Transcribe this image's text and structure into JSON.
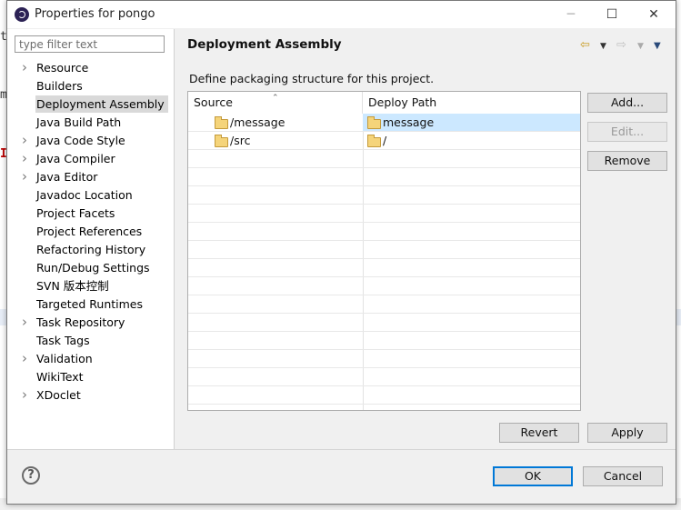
{
  "window": {
    "title": "Properties for pongo",
    "minimize_glyph": "─",
    "maximize_glyph": "☐",
    "close_glyph": "✕"
  },
  "background_editor": {
    "chars": [
      "t",
      "m",
      "I"
    ]
  },
  "filter": {
    "placeholder": "type filter text",
    "value": ""
  },
  "nav": {
    "items": [
      {
        "label": "Resource",
        "expandable": true
      },
      {
        "label": "Builders",
        "expandable": false
      },
      {
        "label": "Deployment Assembly",
        "expandable": false,
        "selected": true
      },
      {
        "label": "Java Build Path",
        "expandable": false
      },
      {
        "label": "Java Code Style",
        "expandable": true
      },
      {
        "label": "Java Compiler",
        "expandable": true
      },
      {
        "label": "Java Editor",
        "expandable": true
      },
      {
        "label": "Javadoc Location",
        "expandable": false
      },
      {
        "label": "Project Facets",
        "expandable": false
      },
      {
        "label": "Project References",
        "expandable": false
      },
      {
        "label": "Refactoring History",
        "expandable": false
      },
      {
        "label": "Run/Debug Settings",
        "expandable": false
      },
      {
        "label": "SVN 版本控制",
        "expandable": false
      },
      {
        "label": "Targeted Runtimes",
        "expandable": false
      },
      {
        "label": "Task Repository",
        "expandable": true
      },
      {
        "label": "Task Tags",
        "expandable": false
      },
      {
        "label": "Validation",
        "expandable": true
      },
      {
        "label": "WikiText",
        "expandable": false
      },
      {
        "label": "XDoclet",
        "expandable": true
      }
    ]
  },
  "page": {
    "title": "Deployment Assembly",
    "description": "Define packaging structure for this project.",
    "back_icon": "back-arrow-icon",
    "forward_icon": "forward-arrow-icon"
  },
  "table": {
    "headers": {
      "source": "Source",
      "deploy_path": "Deploy Path"
    },
    "rows": [
      {
        "source": "/message",
        "deploy_path": "message",
        "selected": true
      },
      {
        "source": "/src",
        "deploy_path": "/",
        "selected": false
      }
    ],
    "empty_row_count": 15
  },
  "buttons": {
    "add": "Add...",
    "edit": "Edit...",
    "remove": "Remove",
    "revert": "Revert",
    "apply": "Apply",
    "ok": "OK",
    "cancel": "Cancel"
  },
  "colors": {
    "selection_row": "#cce8ff",
    "nav_selection": "#d9d9d9",
    "default_button_border": "#0078d7"
  }
}
